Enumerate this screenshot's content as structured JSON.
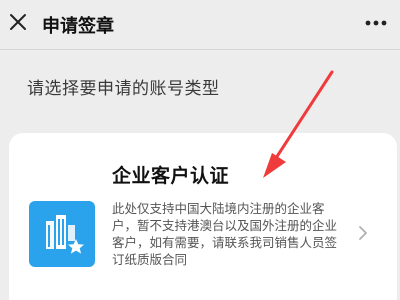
{
  "nav": {
    "title": "申请签章",
    "close_icon": "close-icon",
    "more_icon": "more-icon"
  },
  "prompt": "请选择要申请的账号类型",
  "card": {
    "heading": "企业客户认证",
    "description": "此处仅支持中国大陆境内注册的企业客户，暂不支持港澳台以及国外注册的企业客户，如有需要，请联系我司销售人员签订纸质版合同",
    "logo_icon": "building-star-icon",
    "chevron_icon": "chevron-right-icon",
    "logo_color": "#2aa3ec"
  },
  "annotation": {
    "arrow_color": "#ef3b3b"
  }
}
